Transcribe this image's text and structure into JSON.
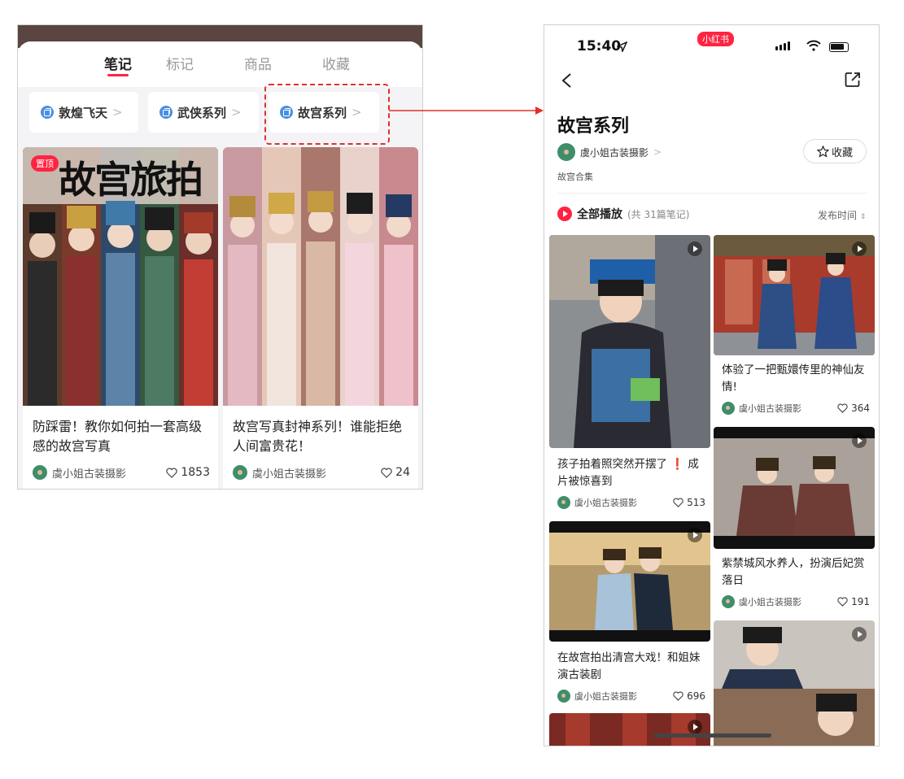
{
  "left": {
    "tabs": [
      {
        "label": "笔记",
        "active": true
      },
      {
        "label": "标记",
        "active": false
      },
      {
        "label": "商品",
        "active": false
      },
      {
        "label": "收藏",
        "active": false
      }
    ],
    "collections": [
      {
        "label": "敦煌飞天"
      },
      {
        "label": "武侠系列"
      },
      {
        "label": "故宫系列"
      }
    ],
    "notes": [
      {
        "pin_label": "置顶",
        "cover_text": "故宫旅拍",
        "title": "防踩雷！教你如何拍一套高级感的故宫写真",
        "author": "虞小姐古装摄影",
        "likes": "1853"
      },
      {
        "title": "故宫写真封神系列！谁能拒绝人间富贵花！",
        "author": "虞小姐古装摄影",
        "likes": "24"
      }
    ]
  },
  "phone": {
    "status": {
      "time": "15:40",
      "app_badge": "小红书"
    },
    "title": "故宫系列",
    "creator": "虞小姐古装摄影",
    "favorite_label": "收藏",
    "description": "故宫合集",
    "play_all_label": "全部播放",
    "play_all_count": "(共 31篇笔记)",
    "sort_label": "发布时间",
    "notes": [
      {
        "title": "孩子拍着照突然开摆了",
        "title_emoji": "❗",
        "title_tail": "成片被惊喜到",
        "author": "虞小姐古装摄影",
        "likes": "513"
      },
      {
        "title": "在故宫拍出清宫大戏！和姐妹演古装剧",
        "author": "虞小姐古装摄影",
        "likes": "696"
      },
      {
        "title": "体验了一把甄嬛传里的神仙友情!",
        "author": "虞小姐古装摄影",
        "likes": "364"
      },
      {
        "title": "紫禁城风水养人，扮演后妃赏落日",
        "author": "虞小姐古装摄影",
        "likes": "191"
      }
    ]
  },
  "colors": {
    "brand_red": "#ff2442",
    "highlight": "#e0312d",
    "chip_icon": "#4a90e2"
  }
}
